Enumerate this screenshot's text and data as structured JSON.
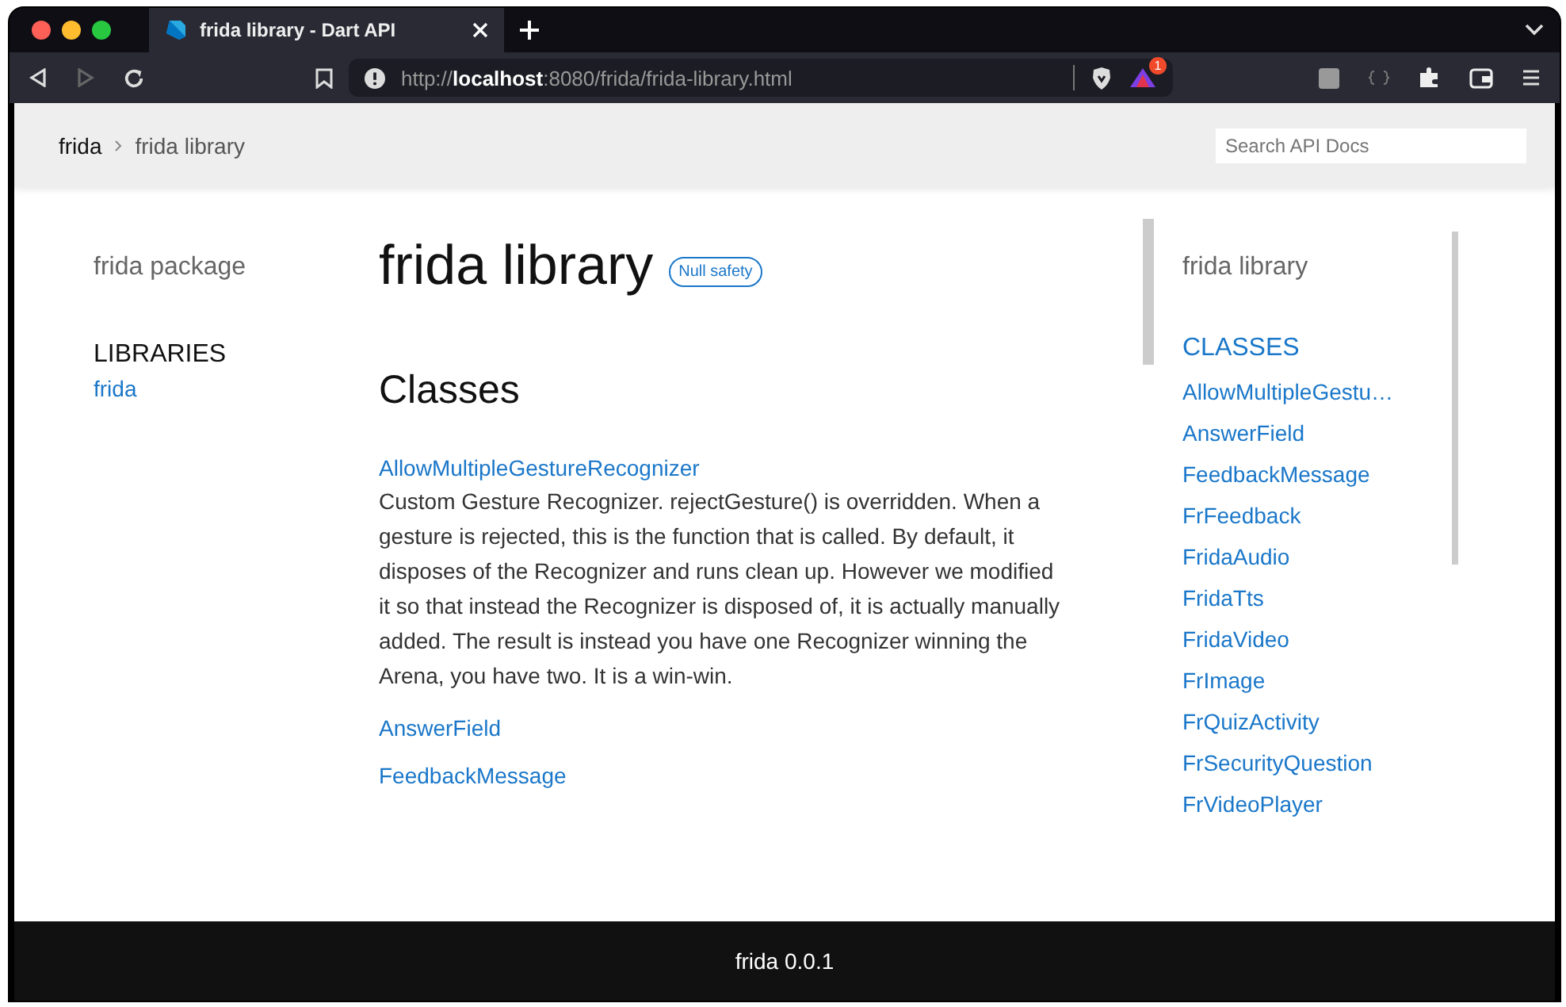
{
  "browser": {
    "tab": {
      "title": "frida library - Dart API",
      "selected": true
    },
    "url": "http://**localhost**:8080/frida/frida-library.html",
    "shield_badge": "1"
  },
  "breadcrumbs": [
    {
      "label": "frida",
      "current": false
    },
    {
      "label": "frida library",
      "current": true
    }
  ],
  "search": {
    "placeholder": "Search API Docs"
  },
  "left_sidebar": {
    "title": "frida package",
    "section": "LIBRARIES",
    "items": [
      "frida"
    ]
  },
  "main": {
    "title": "frida library",
    "badge": "Null safety",
    "section": "Classes",
    "classes": [
      {
        "name": "AllowMultipleGestureRecognizer",
        "description": "Custom Gesture Recognizer. rejectGesture() is overridden. When a gesture is rejected, this is the function that is called. By default, it disposes of the Recognizer and runs clean up. However we modified it so that instead the Recognizer is disposed of, it is actually manually added. The result is instead you have one Recognizer winning the Arena, you have two. It is a win-win."
      },
      {
        "name": "AnswerField"
      },
      {
        "name": "FeedbackMessage"
      }
    ]
  },
  "right_sidebar": {
    "title": "frida library",
    "section": "CLASSES",
    "items": [
      "AllowMultipleGestu…",
      "AnswerField",
      "FeedbackMessage",
      "FrFeedback",
      "FridaAudio",
      "FridaTts",
      "FridaVideo",
      "FrImage",
      "FrQuizActivity",
      "FrSecurityQuestion",
      "FrVideoPlayer"
    ]
  },
  "footer": "frida 0.0.1"
}
